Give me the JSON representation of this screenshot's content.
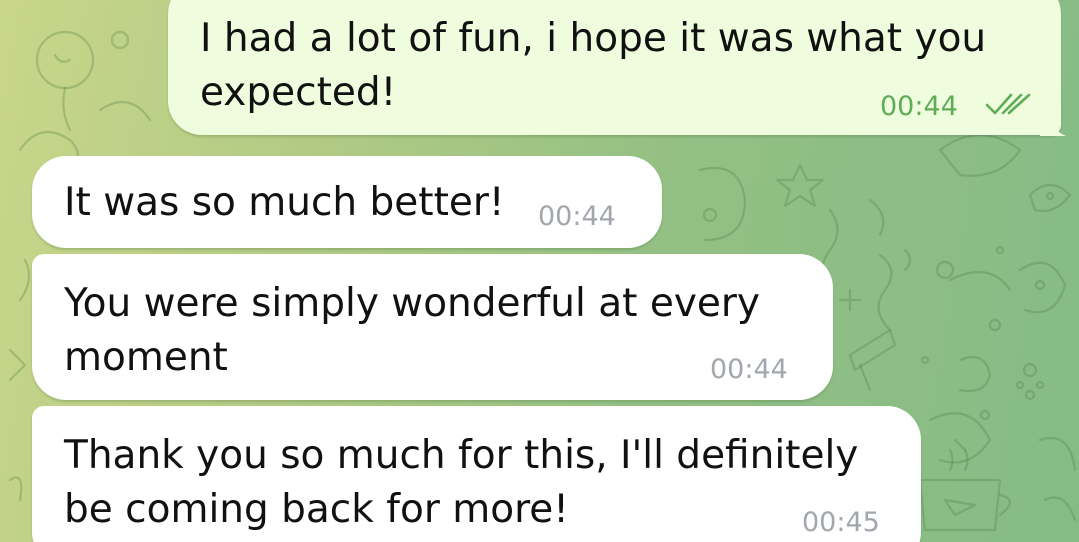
{
  "colors": {
    "outgoing_bubble": "#effdde",
    "incoming_bubble": "#ffffff",
    "outgoing_time": "#5fac57",
    "incoming_time": "#a1a7ad",
    "background_start": "#c9d68a",
    "background_end": "#86bb86"
  },
  "messages": [
    {
      "direction": "outgoing",
      "lines": [
        "I had a lot of fun, i hope it was what you",
        "expected!"
      ],
      "time": "00:44",
      "status_icon": "double-check-icon"
    },
    {
      "direction": "incoming",
      "lines": [
        "It was so much better!"
      ],
      "time": "00:44"
    },
    {
      "direction": "incoming",
      "lines": [
        "You were simply wonderful at every",
        "moment"
      ],
      "time": "00:44"
    },
    {
      "direction": "incoming",
      "lines": [
        "Thank you so much for this, I'll definitely",
        "be coming back for more!"
      ],
      "time": "00:45"
    }
  ]
}
